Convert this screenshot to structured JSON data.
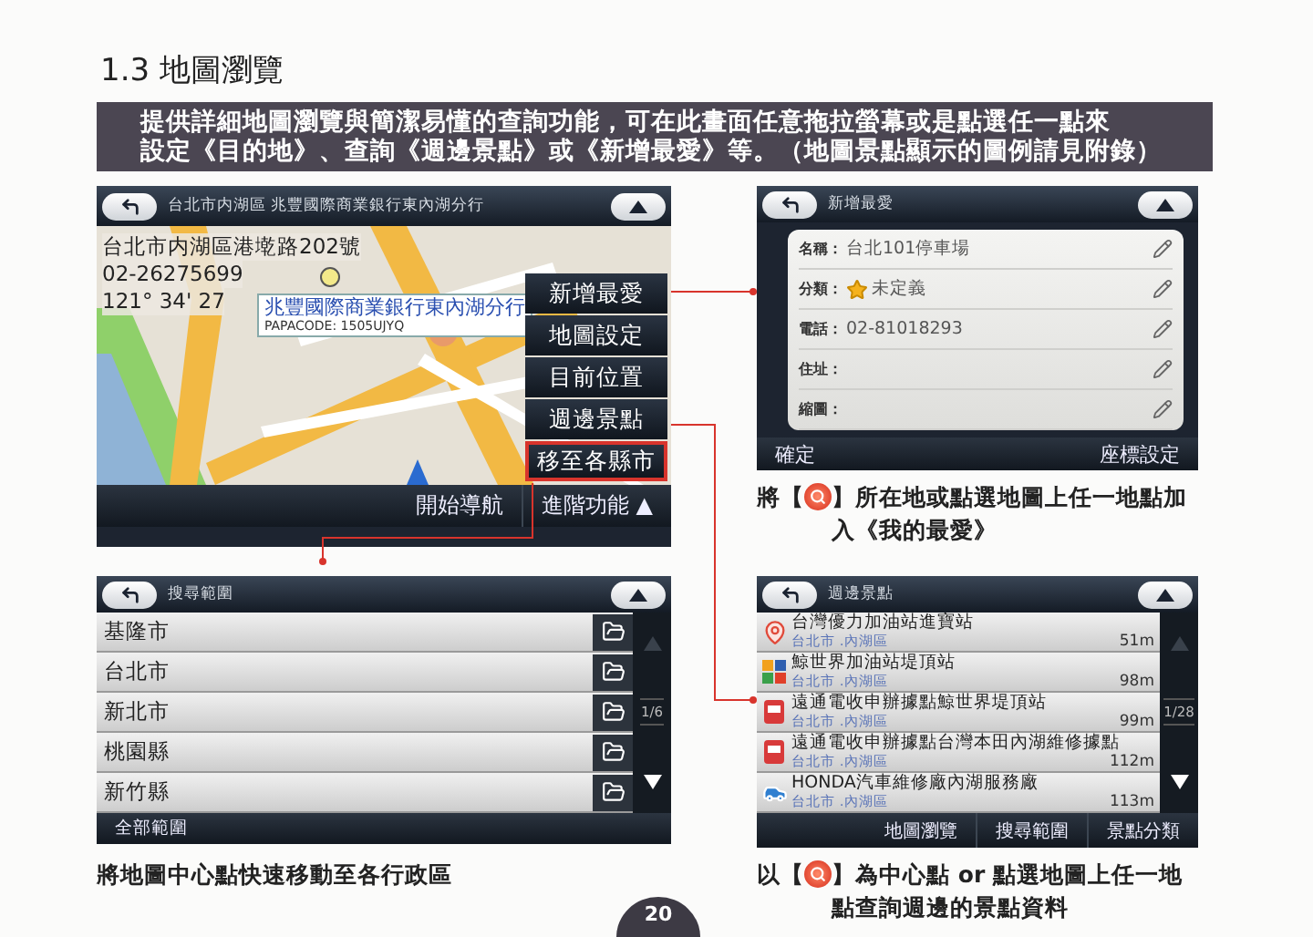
{
  "heading": "1.3 地圖瀏覽",
  "intro": [
    "提供詳細地圖瀏覽與簡潔易懂的查詢功能，可在此畫面任意拖拉螢幕或是點選任一點來",
    "設定《目的地》、查詢《週邊景點》或《新增最愛》等。（地圖景點顯示的圖例請見附錄）"
  ],
  "map_screen": {
    "title": "台北市内湖區 兆豐國際商業銀行東內湖分行",
    "info_lines": [
      "台北市内湖區港墘路202號",
      "02-26275699",
      "121° 34' 27"
    ],
    "popup": {
      "name": "兆豐國際商業銀行東內湖分行",
      "code": "PAPACODE: 1505UJYQ"
    },
    "menu": [
      {
        "label": "新增最愛",
        "highlighted": false
      },
      {
        "label": "地圖設定",
        "highlighted": false
      },
      {
        "label": "目前位置",
        "highlighted": false
      },
      {
        "label": "週邊景點",
        "highlighted": false
      },
      {
        "label": "移至各縣市",
        "highlighted": true
      }
    ],
    "buttons": [
      {
        "label": "開始導航"
      },
      {
        "label": "進階功能",
        "caret": "▲"
      }
    ]
  },
  "favorite_screen": {
    "title": "新增最愛",
    "fields": [
      {
        "label": "名稱：",
        "value": "台北101停車場",
        "star": false
      },
      {
        "label": "分類：",
        "value": "未定義",
        "star": true
      },
      {
        "label": "電話：",
        "value": "02-81018293",
        "star": false
      },
      {
        "label": "住址：",
        "star": false
      },
      {
        "label": "縮圖：",
        "star": false
      }
    ],
    "buttons": [
      "確定",
      "座標設定"
    ],
    "caption": {
      "before": "將【",
      "after": "】所在地或點選地圖上任一地點加入《我的最愛》"
    }
  },
  "region_screen": {
    "title": "搜尋範圍",
    "rows": [
      "基隆市",
      "台北市",
      "新北市",
      "桃園縣",
      "新竹縣"
    ],
    "page": "1/6",
    "buttons": [
      "全部範圍"
    ],
    "caption": "將地圖中心點快速移動至各行政區"
  },
  "poi_screen": {
    "title": "週邊景點",
    "rows": [
      {
        "name": "台灣優力加油站進寶站",
        "area": "台北市 .內湖區",
        "distance": "51m",
        "kind": "pin"
      },
      {
        "name": "鯨世界加油站堤頂站",
        "area": "台北市 .內湖區",
        "distance": "98m",
        "kind": "station"
      },
      {
        "name": "遠通電收申辦據點鯨世界堤頂站",
        "area": "台北市 .內湖區",
        "distance": "99m",
        "kind": "toll"
      },
      {
        "name": "遠通電收申辦據點台灣本田內湖維修據點",
        "area": "台北市 .內湖區",
        "distance": "112m",
        "kind": "toll"
      },
      {
        "name": "HONDA汽車維修廠內湖服務廠",
        "area": "台北市 .內湖區",
        "distance": "113m",
        "kind": "car"
      }
    ],
    "page": "1/28",
    "buttons": [
      "地圖瀏覽",
      "搜尋範圍",
      "景點分類"
    ],
    "caption": {
      "before": "以【",
      "after": "】為中心點 or 點選地圖上任一地點查詢週邊的景點資料"
    }
  },
  "page_number": "20"
}
